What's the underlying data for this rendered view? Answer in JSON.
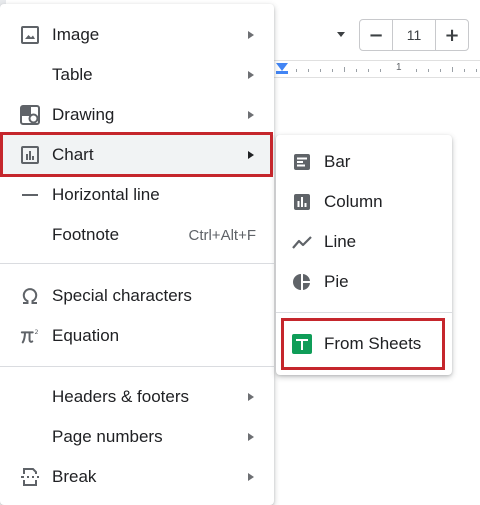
{
  "toolbar": {
    "font_size": "11",
    "decrease_label": "−",
    "increase_label": "+"
  },
  "ruler": {
    "marker_number": "1"
  },
  "insert_menu": {
    "items": [
      {
        "label": "Image",
        "icon": "image-icon",
        "submenu": true
      },
      {
        "label": "Table",
        "icon": "",
        "submenu": true
      },
      {
        "label": "Drawing",
        "icon": "drawing-icon",
        "submenu": true
      },
      {
        "label": "Chart",
        "icon": "chart-icon",
        "submenu": true
      },
      {
        "label": "Horizontal line",
        "icon": "horizontal-line-icon",
        "submenu": false
      },
      {
        "label": "Footnote",
        "icon": "",
        "shortcut": "Ctrl+Alt+F",
        "submenu": false
      },
      {
        "label": "Special characters",
        "icon": "omega-icon",
        "submenu": false
      },
      {
        "label": "Equation",
        "icon": "pi-icon",
        "submenu": false
      },
      {
        "label": "Headers & footers",
        "icon": "",
        "submenu": true
      },
      {
        "label": "Page numbers",
        "icon": "",
        "submenu": true
      },
      {
        "label": "Break",
        "icon": "break-icon",
        "submenu": true
      }
    ]
  },
  "chart_submenu": {
    "items": [
      {
        "label": "Bar",
        "icon": "bar-chart-icon"
      },
      {
        "label": "Column",
        "icon": "column-chart-icon"
      },
      {
        "label": "Line",
        "icon": "line-chart-icon"
      },
      {
        "label": "Pie",
        "icon": "pie-chart-icon"
      },
      {
        "label": "From Sheets",
        "icon": "sheets-icon"
      }
    ]
  },
  "colors": {
    "highlight_border": "#c5262c",
    "sheets_green": "#0f9d58",
    "ruler_blue": "#4285f4",
    "icon_gray": "#5f6368"
  }
}
